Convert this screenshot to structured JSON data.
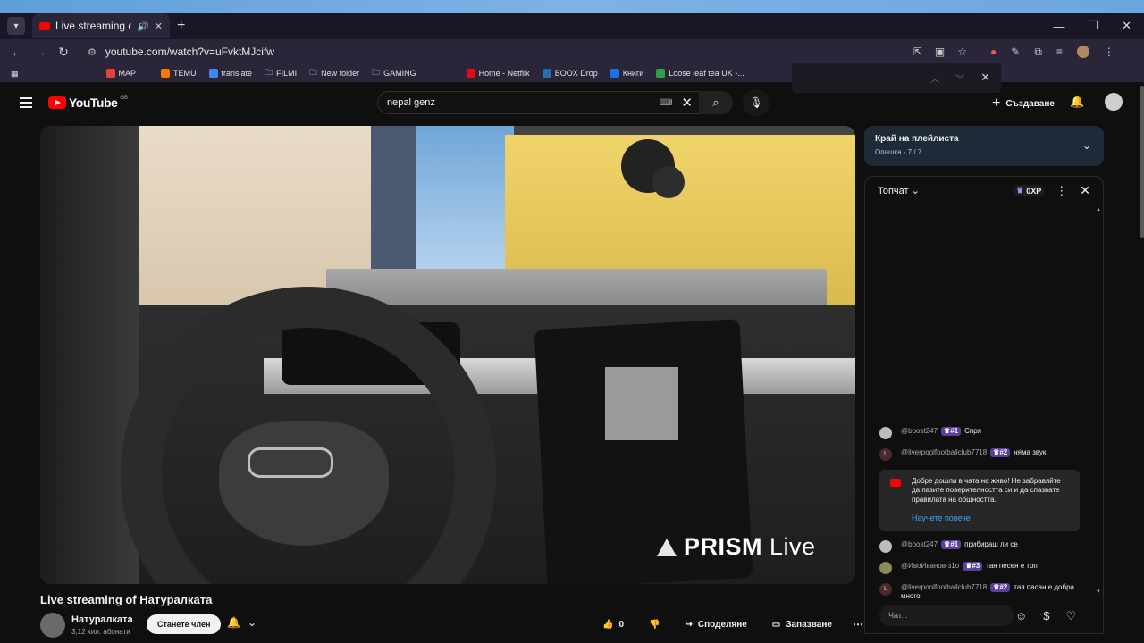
{
  "browser": {
    "tab_title": "Live streaming of Натуралк",
    "url": "youtube.com/watch?v=uFvktMJcifw",
    "bookmarks": [
      "MAP",
      "TEMU",
      "translate",
      "FILMI",
      "New folder",
      "GAMING",
      "Home - Netflix",
      "BOOX Drop",
      "Книги",
      "Loose leaf tea UK -..."
    ]
  },
  "youtube": {
    "logo_text": "YouTube",
    "region": "GB",
    "search_value": "nepal genz",
    "create_label": "Създаване"
  },
  "video": {
    "overlay_brand_bold": "PRISM",
    "overlay_brand_light": "Live",
    "title": "Live streaming of Натуралката",
    "channel_name": "Натуралката",
    "channel_subs": "3,12 хил. абонати",
    "join_label": "Станете член",
    "likes": "0",
    "share_label": "Споделяне",
    "save_label": "Запазване"
  },
  "playlist": {
    "title": "Край на плейлиста",
    "subtitle": "Опашка - 7 / 7"
  },
  "chat": {
    "mode_label": "Топчат",
    "xp": "0XP",
    "messages_top": [
      {
        "name": "@boost247",
        "badge": "#1",
        "text": "Спря"
      },
      {
        "name": "@liverpoolfootballclub7718",
        "badge": "#2",
        "text": "няма звук"
      }
    ],
    "notice_text": "Добре дошли в чата на живо! Не забравяйте да пазите поверителността си и да спазвате правилата на общността.",
    "notice_link": "Научете повече",
    "messages_bottom": [
      {
        "name": "@boost247",
        "badge": "#1",
        "text": "прибираш ли се"
      },
      {
        "name": "@ИвоИванов-з1о",
        "badge": "#3",
        "text": "тая песен е топ"
      },
      {
        "name": "@liverpoolfootballclub7718",
        "badge": "#2",
        "text": "тая пасан е добра много"
      }
    ],
    "input_placeholder": "Чат..."
  },
  "colors": {
    "yt_red": "#ff0000",
    "badge_purple": "#5b3fa0",
    "link_blue": "#3ea6ff"
  }
}
